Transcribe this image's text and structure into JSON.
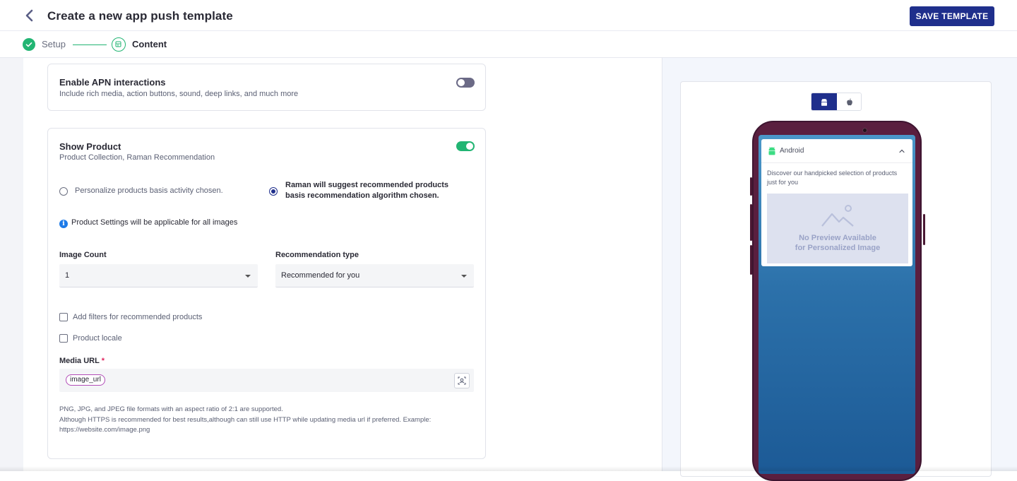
{
  "header": {
    "title": "Create a new app push template",
    "save_label": "SAVE TEMPLATE"
  },
  "stepper": {
    "steps": [
      {
        "label": "Setup",
        "status": "done"
      },
      {
        "label": "Content",
        "status": "active"
      }
    ]
  },
  "apn_card": {
    "title": "Enable APN interactions",
    "subtitle": "Include rich media, action buttons, sound, deep links, and much more",
    "enabled": false
  },
  "product_card": {
    "title": "Show Product",
    "subtitle": "Product Collection, Raman Recommendation",
    "enabled": true,
    "options": [
      {
        "label": "Personalize products basis activity chosen.",
        "selected": false
      },
      {
        "label_line1": "Raman will suggest recommended products",
        "label_line2": "basis recommendation algorithm chosen.",
        "selected": true
      }
    ],
    "info": "Product Settings will be applicable for all images",
    "image_count": {
      "label": "Image Count",
      "value": "1"
    },
    "recommendation_type": {
      "label": "Recommendation type",
      "value": "Recommended for you"
    },
    "checkboxes": [
      {
        "label": "Add filters for recommended products",
        "checked": false
      },
      {
        "label": "Product locale",
        "checked": false
      }
    ],
    "media_url": {
      "label": "Media URL",
      "required_mark": "*",
      "tag": "image_url"
    },
    "help": {
      "line1": "PNG, JPG, and JPEG file formats with an aspect ratio of 2:1 are supported.",
      "line2": "Although HTTPS is recommended for best results,although can still use HTTP while updating media url if preferred. Example:",
      "line3": "https://website.com/image.png"
    }
  },
  "preview": {
    "os_options": [
      "android",
      "ios"
    ],
    "selected_os": "android",
    "notification": {
      "app_name": "Android",
      "body": "Discover our handpicked selection of products just for you",
      "placeholder_line1": "No Preview Available",
      "placeholder_line2": "for Personalized Image"
    }
  },
  "colors": {
    "brand": "#1f2f8c",
    "success": "#22b573",
    "toggle_off": "#6b6a86",
    "info": "#1e7be8"
  }
}
